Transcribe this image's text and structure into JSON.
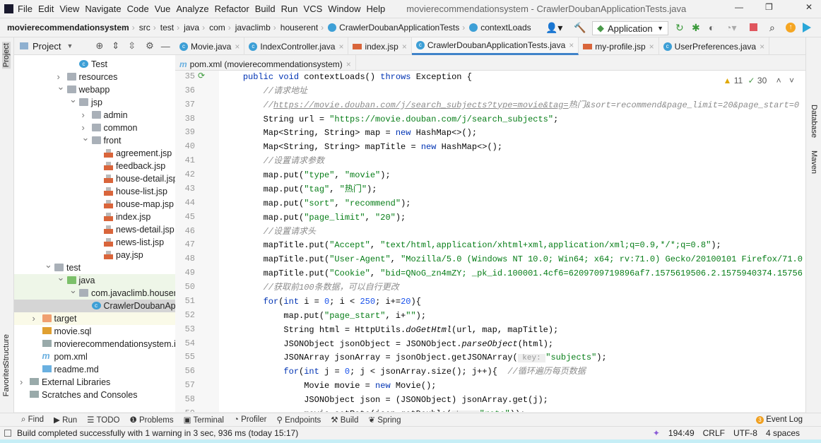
{
  "menu": {
    "items": [
      "File",
      "Edit",
      "View",
      "Navigate",
      "Code",
      "Vue",
      "Analyze",
      "Refactor",
      "Build",
      "Run",
      "VCS",
      "Window",
      "Help"
    ],
    "title": "movierecommendationsystem - CrawlerDoubanApplicationTests.java"
  },
  "breadcrumb": [
    "movierecommendationsystem",
    "src",
    "test",
    "java",
    "com",
    "javaclimb",
    "houserent",
    "CrawlerDoubanApplicationTests",
    "contextLoads"
  ],
  "toolbar": {
    "run_config": "Application"
  },
  "project_panel": {
    "title": "Project"
  },
  "tree": [
    {
      "label": "Test",
      "depth": 4,
      "icon": "class"
    },
    {
      "label": "resources",
      "depth": 3,
      "icon": "folder",
      "chev": "right"
    },
    {
      "label": "webapp",
      "depth": 3,
      "icon": "folder",
      "chev": "down"
    },
    {
      "label": "jsp",
      "depth": 4,
      "icon": "folder",
      "chev": "down"
    },
    {
      "label": "admin",
      "depth": 5,
      "icon": "folder",
      "chev": "right"
    },
    {
      "label": "common",
      "depth": 5,
      "icon": "folder",
      "chev": "right"
    },
    {
      "label": "front",
      "depth": 5,
      "icon": "folder",
      "chev": "down"
    },
    {
      "label": "agreement.jsp",
      "depth": 6,
      "icon": "jsp"
    },
    {
      "label": "feedback.jsp",
      "depth": 6,
      "icon": "jsp"
    },
    {
      "label": "house-detail.jsp",
      "depth": 6,
      "icon": "jsp"
    },
    {
      "label": "house-list.jsp",
      "depth": 6,
      "icon": "jsp"
    },
    {
      "label": "house-map.jsp",
      "depth": 6,
      "icon": "jsp"
    },
    {
      "label": "index.jsp",
      "depth": 6,
      "icon": "jsp"
    },
    {
      "label": "news-detail.jsp",
      "depth": 6,
      "icon": "jsp"
    },
    {
      "label": "news-list.jsp",
      "depth": 6,
      "icon": "jsp"
    },
    {
      "label": "pay.jsp",
      "depth": 6,
      "icon": "jsp"
    },
    {
      "label": "test",
      "depth": 2,
      "icon": "folder",
      "chev": "down"
    },
    {
      "label": "java",
      "depth": 3,
      "icon": "test-folder",
      "chev": "down",
      "bg": "#eef6e8"
    },
    {
      "label": "com.javaclimb.houserent",
      "depth": 4,
      "icon": "package",
      "chev": "down",
      "bg": "#eef6e8"
    },
    {
      "label": "CrawlerDoubanApplicationTests",
      "depth": 5,
      "icon": "class",
      "bg": "#d5d5d5"
    },
    {
      "label": "target",
      "depth": 1,
      "icon": "excluded-folder",
      "chev": "right",
      "bg": "#fafae8"
    },
    {
      "label": "movie.sql",
      "depth": 1,
      "icon": "sql"
    },
    {
      "label": "movierecommendationsystem.iml",
      "depth": 1,
      "icon": "iml"
    },
    {
      "label": "pom.xml",
      "depth": 1,
      "icon": "maven"
    },
    {
      "label": "readme.md",
      "depth": 1,
      "icon": "md"
    },
    {
      "label": "External Libraries",
      "depth": 0,
      "icon": "library",
      "chev": "right"
    },
    {
      "label": "Scratches and Consoles",
      "depth": 0,
      "icon": "scratch"
    }
  ],
  "tabs": [
    {
      "label": "Movie.java",
      "icon": "class"
    },
    {
      "label": "IndexController.java",
      "icon": "class"
    },
    {
      "label": "index.jsp",
      "icon": "jsp"
    },
    {
      "label": "CrawlerDoubanApplicationTests.java",
      "icon": "class",
      "active": true
    },
    {
      "label": "my-profile.jsp",
      "icon": "jsp"
    },
    {
      "label": "UserPreferences.java",
      "icon": "class"
    }
  ],
  "tabs2": [
    {
      "label": "pom.xml (movierecommendationsystem)",
      "icon": "maven"
    }
  ],
  "inspections": {
    "warnings": "11",
    "ok": "30"
  },
  "code": [
    {
      "n": "35",
      "t": [
        [
          "",
          "    "
        ],
        [
          "kw",
          "public void "
        ],
        [
          "",
          "contextLoads() "
        ],
        [
          "kw",
          "throws "
        ],
        [
          "",
          "Exception {"
        ]
      ]
    },
    {
      "n": "36",
      "t": [
        [
          "",
          "        "
        ],
        [
          "cm",
          "//请求地址"
        ]
      ]
    },
    {
      "n": "37",
      "t": [
        [
          "",
          "        "
        ],
        [
          "cm",
          "//"
        ],
        [
          "lnk",
          "https://movie.douban.com/j/search_subjects?type=movie&tag="
        ],
        [
          "cm",
          "热门&sort=recommend&page_limit=20&page_start=0"
        ]
      ]
    },
    {
      "n": "38",
      "t": [
        [
          "",
          "        String url = "
        ],
        [
          "str",
          "\"https://movie.douban.com/j/search_subjects\""
        ],
        [
          "",
          ";"
        ]
      ]
    },
    {
      "n": "39",
      "t": [
        [
          "",
          "        Map<String, String> map = "
        ],
        [
          "kw",
          "new "
        ],
        [
          "",
          "HashMap<>();"
        ]
      ]
    },
    {
      "n": "40",
      "t": [
        [
          "",
          "        Map<String, String> mapTitle = "
        ],
        [
          "kw",
          "new "
        ],
        [
          "",
          "HashMap<>();"
        ]
      ]
    },
    {
      "n": "41",
      "t": [
        [
          "",
          "        "
        ],
        [
          "cm",
          "//设置请求参数"
        ]
      ]
    },
    {
      "n": "42",
      "t": [
        [
          "",
          "        map.put("
        ],
        [
          "str",
          "\"type\""
        ],
        [
          "",
          ", "
        ],
        [
          "str",
          "\"movie\""
        ],
        [
          "",
          ");"
        ]
      ]
    },
    {
      "n": "43",
      "t": [
        [
          "",
          "        map.put("
        ],
        [
          "str",
          "\"tag\""
        ],
        [
          "",
          ", "
        ],
        [
          "str",
          "\"热门\""
        ],
        [
          "",
          ");"
        ]
      ]
    },
    {
      "n": "44",
      "t": [
        [
          "",
          "        map.put("
        ],
        [
          "str",
          "\"sort\""
        ],
        [
          "",
          ", "
        ],
        [
          "str",
          "\"recommend\""
        ],
        [
          "",
          ");"
        ]
      ]
    },
    {
      "n": "45",
      "t": [
        [
          "",
          "        map.put("
        ],
        [
          "str",
          "\"page_limit\""
        ],
        [
          "",
          ", "
        ],
        [
          "str",
          "\"20\""
        ],
        [
          "",
          ");"
        ]
      ]
    },
    {
      "n": "46",
      "t": [
        [
          "",
          "        "
        ],
        [
          "cm",
          "//设置请求头"
        ]
      ]
    },
    {
      "n": "47",
      "t": [
        [
          "",
          "        mapTitle.put("
        ],
        [
          "str",
          "\"Accept\""
        ],
        [
          "",
          ", "
        ],
        [
          "str",
          "\"text/html,application/xhtml+xml,application/xml;q=0.9,*/*;q=0.8\""
        ],
        [
          "",
          ");"
        ]
      ]
    },
    {
      "n": "48",
      "t": [
        [
          "",
          "        mapTitle.put("
        ],
        [
          "str",
          "\"User-Agent\""
        ],
        [
          "",
          ", "
        ],
        [
          "str",
          "\"Mozilla/5.0 (Windows NT 10.0; Win64; x64; rv:71.0) Gecko/20100101 Firefox/71.0"
        ]
      ]
    },
    {
      "n": "49",
      "t": [
        [
          "",
          "        mapTitle.put("
        ],
        [
          "str",
          "\"Cookie\""
        ],
        [
          "",
          ", "
        ],
        [
          "str",
          "\"bid=QNoG_zn4mZY; _pk_id.100001.4cf6=6209709719896af7.1575619506.2.1575940374.15756"
        ]
      ]
    },
    {
      "n": "50",
      "t": [
        [
          "",
          "        "
        ],
        [
          "cm",
          "//获取前100条数据，可以自行更改"
        ]
      ]
    },
    {
      "n": "51",
      "t": [
        [
          "",
          "        "
        ],
        [
          "kw",
          "for"
        ],
        [
          "",
          "("
        ],
        [
          "kw",
          "int "
        ],
        [
          "",
          "i = "
        ],
        [
          "num",
          "0"
        ],
        [
          "",
          "; i < "
        ],
        [
          "num",
          "250"
        ],
        [
          "",
          "; i+="
        ],
        [
          "num",
          "20"
        ],
        [
          "",
          "){"
        ]
      ]
    },
    {
      "n": "52",
      "t": [
        [
          "",
          "            map.put("
        ],
        [
          "str",
          "\"page_start\""
        ],
        [
          "",
          ", i+"
        ],
        [
          "str",
          "\"\""
        ],
        [
          "",
          ");"
        ]
      ]
    },
    {
      "n": "53",
      "t": [
        [
          "",
          "            String html = HttpUtils."
        ],
        [
          "it",
          "doGetHtml"
        ],
        [
          "",
          "(url, map, mapTitle);"
        ]
      ]
    },
    {
      "n": "54",
      "t": [
        [
          "",
          "            JSONObject jsonObject = JSONObject."
        ],
        [
          "it",
          "parseObject"
        ],
        [
          "",
          "(html);"
        ]
      ]
    },
    {
      "n": "55",
      "t": [
        [
          "",
          "            JSONArray jsonArray = jsonObject.getJSONArray("
        ],
        [
          "hint",
          " key: "
        ],
        [
          "str",
          "\"subjects\""
        ],
        [
          "",
          ");"
        ]
      ]
    },
    {
      "n": "56",
      "t": [
        [
          "",
          "            "
        ],
        [
          "kw",
          "for"
        ],
        [
          "",
          "("
        ],
        [
          "kw",
          "int "
        ],
        [
          "",
          "j = "
        ],
        [
          "num",
          "0"
        ],
        [
          "",
          "; j < jsonArray.size(); j++){  "
        ],
        [
          "cm",
          "//循环遍历每页数据"
        ]
      ]
    },
    {
      "n": "57",
      "t": [
        [
          "",
          "                Movie movie = "
        ],
        [
          "kw",
          "new "
        ],
        [
          "",
          "Movie();"
        ]
      ]
    },
    {
      "n": "58",
      "t": [
        [
          "",
          "                JSONObject json = (JSONObject) jsonArray.get(j);"
        ]
      ]
    },
    {
      "n": "59",
      "t": [
        [
          "",
          "                movie.setRate(json.getDouble("
        ],
        [
          "hint",
          " key: "
        ],
        [
          "str",
          "\"rate\""
        ],
        [
          "",
          "));"
        ]
      ]
    }
  ],
  "right_stripe": [
    "Database",
    "Maven"
  ],
  "left_stripe": [
    "Project",
    "Structure",
    "Favorites"
  ],
  "tool_windows": [
    "Find",
    "Run",
    "TODO",
    "Problems",
    "Terminal",
    "Profiler",
    "Endpoints",
    "Build",
    "Spring"
  ],
  "event_log": {
    "label": "Event Log",
    "count": "3"
  },
  "status": {
    "message": "Build completed successfully with 1 warning in 3 sec, 936 ms (today 15:17)",
    "position": "194:49",
    "line_sep": "CRLF",
    "encoding": "UTF-8",
    "indent": "4 spaces"
  }
}
